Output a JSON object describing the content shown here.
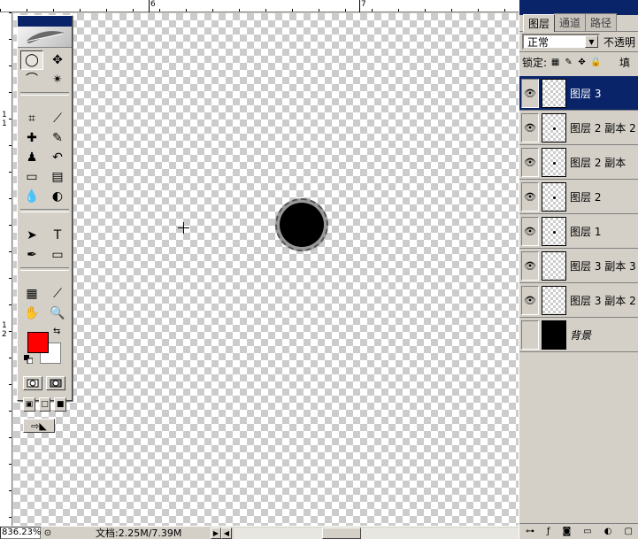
{
  "rulers": {
    "top_labels": [
      "6",
      "7"
    ],
    "left_labels": [
      "1",
      "1",
      "1",
      "2"
    ]
  },
  "toolbox": {
    "tools": [
      {
        "name": "marquee-tool",
        "glyph": "◯"
      },
      {
        "name": "move-tool",
        "glyph": "✥"
      },
      {
        "name": "lasso-tool",
        "glyph": "⌒"
      },
      {
        "name": "magic-wand-tool",
        "glyph": "✴"
      },
      {
        "name": "crop-tool",
        "glyph": "⌗"
      },
      {
        "name": "slice-tool",
        "glyph": "⟋"
      },
      {
        "name": "healing-brush-tool",
        "glyph": "✚"
      },
      {
        "name": "brush-tool",
        "glyph": "✎"
      },
      {
        "name": "clone-stamp-tool",
        "glyph": "♟"
      },
      {
        "name": "history-brush-tool",
        "glyph": "↶"
      },
      {
        "name": "eraser-tool",
        "glyph": "▭"
      },
      {
        "name": "gradient-tool",
        "glyph": "▤"
      },
      {
        "name": "blur-tool",
        "glyph": "💧"
      },
      {
        "name": "dodge-tool",
        "glyph": "◐"
      },
      {
        "name": "path-selection-tool",
        "glyph": "➤"
      },
      {
        "name": "type-tool",
        "glyph": "T"
      },
      {
        "name": "pen-tool",
        "glyph": "✒"
      },
      {
        "name": "shape-tool",
        "glyph": "▭"
      },
      {
        "name": "notes-tool",
        "glyph": "▦"
      },
      {
        "name": "eyedropper-tool",
        "glyph": "⟋"
      },
      {
        "name": "hand-tool",
        "glyph": "✋"
      },
      {
        "name": "zoom-tool",
        "glyph": "🔍"
      }
    ],
    "foreground_color": "#ff0000",
    "background_color": "#ffffff"
  },
  "panel": {
    "tabs": [
      "图层",
      "通道",
      "路径"
    ],
    "blend_mode": "正常",
    "opacity_label": "不透明",
    "lock_label": "锁定:",
    "fill_label": "填",
    "layers": [
      {
        "name": "图层 3",
        "selected": true,
        "visible": true,
        "thumb": "empty"
      },
      {
        "name": "图层 2 副本 2",
        "selected": false,
        "visible": true,
        "thumb": "dot"
      },
      {
        "name": "图层 2 副本",
        "selected": false,
        "visible": true,
        "thumb": "dot"
      },
      {
        "name": "图层 2",
        "selected": false,
        "visible": true,
        "thumb": "dot"
      },
      {
        "name": "图层 1",
        "selected": false,
        "visible": true,
        "thumb": "dot"
      },
      {
        "name": "图层 3 副本 3",
        "selected": false,
        "visible": true,
        "thumb": "empty"
      },
      {
        "name": "图层 3 副本 2",
        "selected": false,
        "visible": true,
        "thumb": "empty"
      },
      {
        "name": "背景",
        "selected": false,
        "visible": false,
        "thumb": "black"
      }
    ]
  },
  "status": {
    "zoom": "836.23%",
    "doc_info": "文档:2.25M/7.39M"
  }
}
